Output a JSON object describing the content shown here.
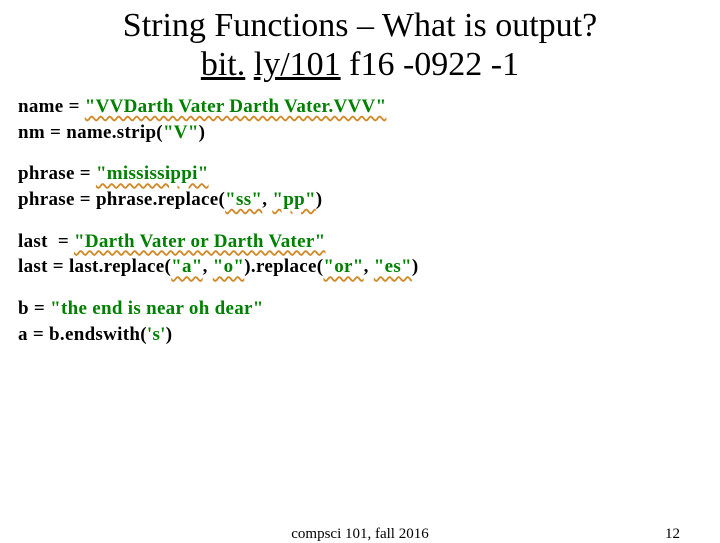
{
  "title": {
    "line1": "String Functions – What is output?",
    "line2_a": "bit.",
    "line2_b": "ly/101",
    "line2_c": " ",
    "line2_d": "f",
    "line2_e": " ",
    "line2_f": "16 -0922 -1"
  },
  "code": {
    "l1_a": "name ",
    "l1_eq": "= ",
    "l1_str": "\"VVDarth Vater Darth Vater.VVV\"",
    "l2_a": "nm ",
    "l2_eq": "= ",
    "l2_b": "name.strip(",
    "l2_str": "\"V\"",
    "l2_c": ")",
    "l3_a": "phrase ",
    "l3_eq": "= ",
    "l3_str": "\"mississippi\"",
    "l4_a": "phrase ",
    "l4_eq": "= ",
    "l4_b": "phrase.replace(",
    "l4_str1": "\"ss\"",
    "l4_c": ", ",
    "l4_str2": "\"pp\"",
    "l4_d": ")",
    "l5_a": "last  ",
    "l5_eq": "= ",
    "l5_str": "\"Darth Vater or Darth Vater\"",
    "l6_a": "last ",
    "l6_eq": "= ",
    "l6_b": "last.replace(",
    "l6_str1": "\"a\"",
    "l6_c": ", ",
    "l6_str2": "\"o\"",
    "l6_d": ").replace(",
    "l6_str3": "\"or\"",
    "l6_e": ", ",
    "l6_str4": "\"es\"",
    "l6_f": ")",
    "l7_a": "b ",
    "l7_eq": "= ",
    "l7_str": "\"the end is near oh dear\"",
    "l8_a": "a ",
    "l8_eq": "= ",
    "l8_b": "b.endswith(",
    "l8_str": "'s'",
    "l8_c": ")"
  },
  "footer": {
    "center": "compsci 101, fall 2016",
    "page": "12"
  }
}
